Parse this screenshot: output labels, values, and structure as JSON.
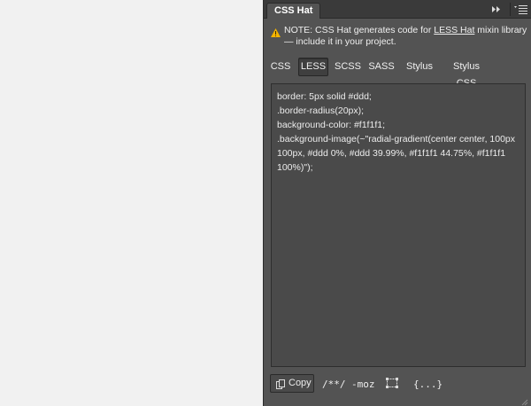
{
  "panel": {
    "title": "CSS Hat"
  },
  "note": {
    "prefix": "NOTE: CSS Hat generates code for ",
    "link": "LESS Hat",
    "suffix": " mixin library — include it in your project."
  },
  "tabs": [
    "CSS",
    "LESS",
    "SCSS",
    "SASS",
    "Stylus",
    "Stylus CSS"
  ],
  "active_tab": "LESS",
  "code": {
    "lines": [
      "border: 5px solid #ddd;",
      ".border-radius(20px);",
      "background-color: #f1f1f1;",
      ".background-image(~\"radial-gradient(center center, 100px 100px, #ddd 0%, #ddd 39.99%, #f1f1f1 44.75%, #f1f1f1 100%)\");"
    ]
  },
  "toolbar": {
    "copy_label": "Copy",
    "comments_label": "/**/",
    "vendor_label": "-moz",
    "braces_label": "{...}"
  },
  "icons": {
    "warning": "warning-icon",
    "collapse": "double-chevron-right-icon",
    "menu": "panel-menu-icon",
    "copy": "copy-icon",
    "frame": "selection-frame-icon"
  },
  "colors": {
    "panel_bg": "#535353",
    "titlebar_bg": "#3a3a3a",
    "code_bg": "#4a4a4a",
    "canvas_bg": "#f1f1f1",
    "warning": "#f5b400"
  }
}
